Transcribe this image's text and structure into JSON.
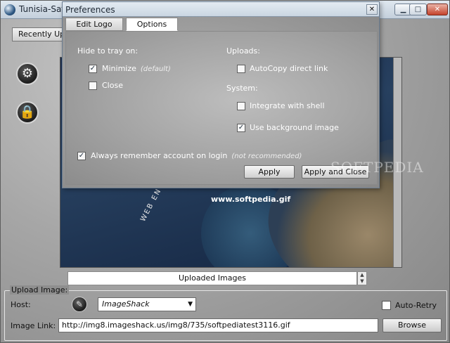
{
  "main": {
    "title": "Tunisia-Sat",
    "window_controls": {
      "minimize": "▁",
      "maximize": "□",
      "close": "✕"
    },
    "recent_tab": "Recently Upl",
    "side_buttons": {
      "settings_icon": "⚙",
      "lock_icon": "🔒"
    },
    "image_panel": {
      "watermark_url": "www.softpedia.gif",
      "web_label": "WEB ENT"
    },
    "uploaded_images_label": "Uploaded Images",
    "upload": {
      "legend": "Upload Image:",
      "host_label": "Host:",
      "host_value": "ImageShack",
      "auto_retry_label": "Auto-Retry",
      "image_link_label": "Image Link:",
      "image_link_value": "http://img8.imageshack.us/img8/735/softpediatest3116.gif",
      "browse_label": "Browse"
    }
  },
  "prefs": {
    "title": "Preferences",
    "close": "✕",
    "tabs": [
      {
        "label": "Edit Logo"
      },
      {
        "label": "Options"
      }
    ],
    "hide_to_tray": {
      "label": "Hide to tray on:",
      "minimize": {
        "label": "Minimize",
        "note": "(default)",
        "checked": true
      },
      "close": {
        "label": "Close",
        "checked": false
      }
    },
    "uploads": {
      "label": "Uploads:",
      "autocopy": {
        "label": "AutoCopy direct link",
        "checked": false
      }
    },
    "system": {
      "label": "System:",
      "integrate": {
        "label": "Integrate with shell",
        "checked": false
      },
      "background": {
        "label": "Use background image",
        "checked": true
      }
    },
    "remember": {
      "label": "Always remember account on login",
      "note": "(not recommended)",
      "checked": true
    },
    "apply_label": "Apply",
    "apply_close_label": "Apply and Close",
    "check_glyph": "✓"
  },
  "watermark": "SOFTPEDIA",
  "colors": {
    "titlebar": "#cad6e2",
    "panel_sea": "#27405f",
    "dialog_bg": "#999999"
  }
}
